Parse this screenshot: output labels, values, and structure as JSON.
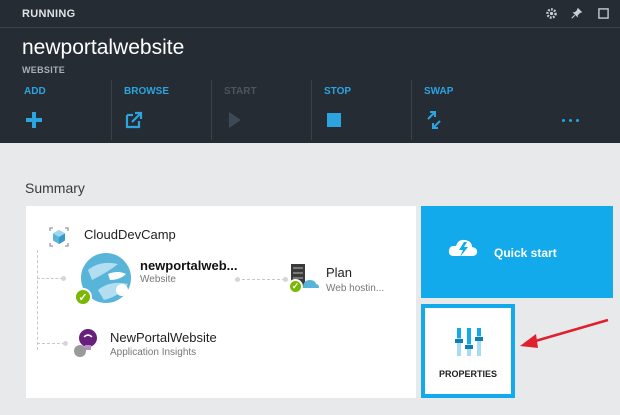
{
  "status": {
    "text": "RUNNING"
  },
  "window_controls": [
    {
      "name": "settings-icon",
      "glyph": "⚙"
    },
    {
      "name": "pin-icon",
      "glyph": "📌"
    },
    {
      "name": "maximize-icon",
      "glyph": "☐"
    }
  ],
  "header": {
    "title": "newportalwebsite",
    "subtitle": "WEBSITE"
  },
  "commands": [
    {
      "label": "ADD",
      "icon": "plus-icon",
      "enabled": true
    },
    {
      "label": "BROWSE",
      "icon": "browse-icon",
      "enabled": true
    },
    {
      "label": "START",
      "icon": "play-icon",
      "enabled": false
    },
    {
      "label": "STOP",
      "icon": "stop-icon",
      "enabled": true
    },
    {
      "label": "SWAP",
      "icon": "swap-icon",
      "enabled": true
    }
  ],
  "summary": {
    "title": "Summary",
    "resource_group": {
      "label": "CloudDevCamp",
      "icon": "resource-group-icon"
    },
    "website": {
      "title": "newportalweb...",
      "subtitle": "Website",
      "icon": "website-globe-icon"
    },
    "plan": {
      "title": "Plan",
      "subtitle": "Web hostin...",
      "icon": "hosting-plan-icon"
    },
    "insights": {
      "title": "NewPortalWebsite",
      "subtitle": "Application Insights",
      "icon": "lightbulb-icon"
    }
  },
  "tiles": {
    "quick_start": {
      "label": "Quick start",
      "icon": "cloud-bolt-icon"
    },
    "properties": {
      "label": "PROPERTIES",
      "icon": "sliders-icon"
    }
  },
  "colors": {
    "header_bg": "#252c33",
    "accent": "#12aaeb",
    "command_blue": "#2ba4e0",
    "success_green": "#7ab800",
    "annotation_red": "#e0202e"
  }
}
